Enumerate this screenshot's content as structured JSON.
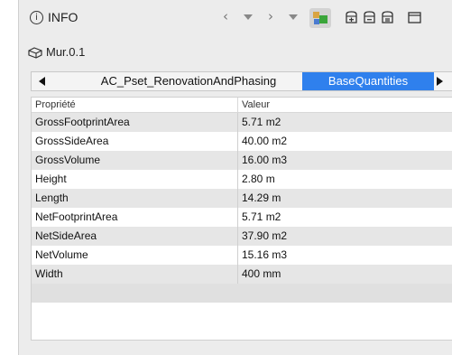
{
  "header": {
    "title": "INFO",
    "info_glyph": "i"
  },
  "object": {
    "name": "Mur.0.1"
  },
  "tabs": [
    {
      "label": "AC_Pset_RenovationAndPhasing",
      "active": false
    },
    {
      "label": "BaseQuantities",
      "active": true
    }
  ],
  "table": {
    "col1": "Propriété",
    "col2": "Valeur",
    "rows": [
      {
        "prop": "GrossFootprintArea",
        "val": "5.71 m2"
      },
      {
        "prop": "GrossSideArea",
        "val": "40.00 m2"
      },
      {
        "prop": "GrossVolume",
        "val": "16.00 m3"
      },
      {
        "prop": "Height",
        "val": "2.80 m"
      },
      {
        "prop": "Length",
        "val": "14.29 m"
      },
      {
        "prop": "NetFootprintArea",
        "val": "5.71 m2"
      },
      {
        "prop": "NetSideArea",
        "val": "37.90 m2"
      },
      {
        "prop": "NetVolume",
        "val": "15.16 m3"
      },
      {
        "prop": "Width",
        "val": "400 mm"
      }
    ]
  },
  "colors": {
    "active_tab": "#2f80ed",
    "panel": "#ececec",
    "row_alt": "#e6e6e6"
  },
  "icons": [
    "info-icon",
    "back-icon",
    "forward-icon",
    "dropdown-icon",
    "color-cube-icon",
    "add-set-icon",
    "edit-set-icon",
    "remove-set-icon",
    "window-icon",
    "wall-icon"
  ]
}
